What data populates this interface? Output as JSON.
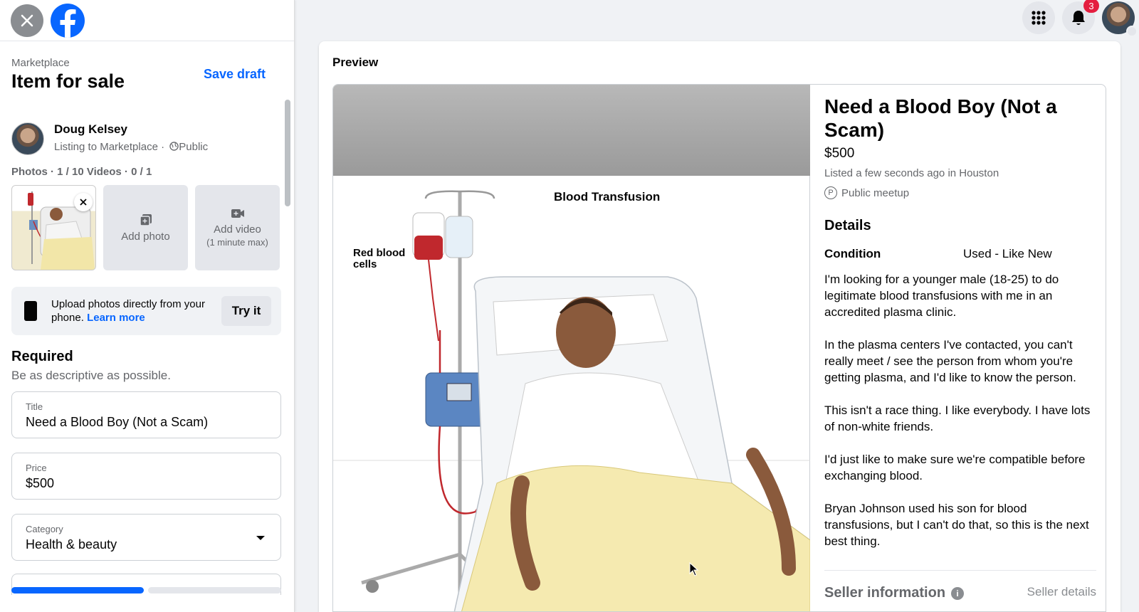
{
  "sidebar": {
    "breadcrumb": "Marketplace",
    "title": "Item for sale",
    "save_draft": "Save draft",
    "user": {
      "name": "Doug Kelsey",
      "listing_to": "Listing to Marketplace ·",
      "audience": "Public"
    },
    "photos_label": "Photos · 1 / 10 Videos · 0 / 1",
    "tiles": {
      "add_photo": "Add photo",
      "add_video": "Add video",
      "add_video_sub": "(1 minute max)"
    },
    "upload": {
      "text": "Upload photos directly from your phone.",
      "link": "Learn more",
      "button": "Try it"
    },
    "required_heading": "Required",
    "required_sub": "Be as descriptive as possible.",
    "fields": {
      "title_label": "Title",
      "title_value": "Need a Blood Boy (Not a Scam)",
      "price_label": "Price",
      "price_value": "$500",
      "category_label": "Category",
      "category_value": "Health & beauty"
    },
    "progress_fraction": 0.49
  },
  "topbar": {
    "notification_count": "3"
  },
  "preview": {
    "label": "Preview",
    "image_title": "Blood Transfusion",
    "image_label": "Red blood cells",
    "title": "Need a Blood Boy (Not a Scam)",
    "price": "$500",
    "listed": "Listed a few seconds ago in Houston",
    "meetup": "Public meetup",
    "details_heading": "Details",
    "condition_key": "Condition",
    "condition_value": "Used - Like New",
    "description": [
      "I'm looking for a younger male (18-25) to do legitimate blood transfusions with me in an accredited plasma clinic.",
      "In the plasma centers I've contacted, you can't really meet / see the person from whom you're getting plasma, and I'd like to know the person.",
      "This isn't a race thing. I like everybody. I have lots of non-white friends.",
      "I'd just like to make sure we're compatible before exchanging blood.",
      "Bryan Johnson used his son for blood transfusions, but I can't do that, so this is the next best thing."
    ],
    "seller_heading": "Seller information",
    "seller_link": "Seller details"
  },
  "colors": {
    "accent": "#0866ff",
    "badge": "#e41e3f"
  },
  "icons": [
    "close-icon",
    "facebook-logo-icon",
    "globe-icon",
    "add-photo-icon",
    "add-video-icon",
    "phone-icon",
    "chevron-down-icon",
    "grid-menu-icon",
    "bell-icon",
    "info-icon",
    "pin-icon"
  ]
}
